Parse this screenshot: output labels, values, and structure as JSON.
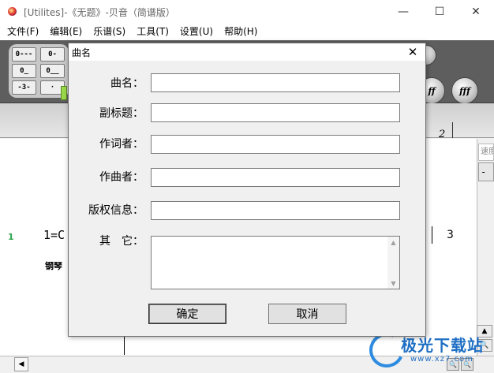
{
  "window": {
    "title": "[Utilites]-《无题》-贝音（简谱版）",
    "minimize_glyph": "—",
    "maximize_glyph": "☐",
    "close_glyph": "✕"
  },
  "menu": {
    "items": [
      "文件(F)",
      "编辑(E)",
      "乐谱(S)",
      "工具(T)",
      "设置(U)",
      "帮助(H)"
    ]
  },
  "toolbar": {
    "keys": [
      "0---",
      "0-",
      "0̲",
      "0̲̲",
      "-3-",
      "·"
    ],
    "dynamics": [
      "ff",
      "fff"
    ]
  },
  "ruler": {
    "number": "2"
  },
  "score": {
    "line_number": "1",
    "key_signature": "1=C",
    "instrument": "钢琴",
    "measure_number": "3"
  },
  "side_panel": {
    "label": "速度",
    "strip_text": "- -"
  },
  "icons": {
    "app": "app-icon",
    "close": "close-icon",
    "arrow_up": "arrow-up-icon",
    "arrow_down": "arrow-down-icon",
    "arrow_left": "arrow-left-icon",
    "zoom": "zoom-icon"
  },
  "dialog": {
    "title": "曲名",
    "close_glyph": "✕",
    "fields": {
      "title": {
        "label": "曲名：",
        "value": ""
      },
      "subtitle": {
        "label": "副标题：",
        "value": ""
      },
      "lyricist": {
        "label": "作词者：",
        "value": ""
      },
      "composer": {
        "label": "作曲者：",
        "value": ""
      },
      "copyright": {
        "label": "版权信息：",
        "value": ""
      },
      "other": {
        "label": "其　它：",
        "value": ""
      }
    },
    "ok_label": "确定",
    "cancel_label": "取消"
  },
  "watermark": {
    "text": "极光下载站",
    "url": "www.xz7.com"
  }
}
